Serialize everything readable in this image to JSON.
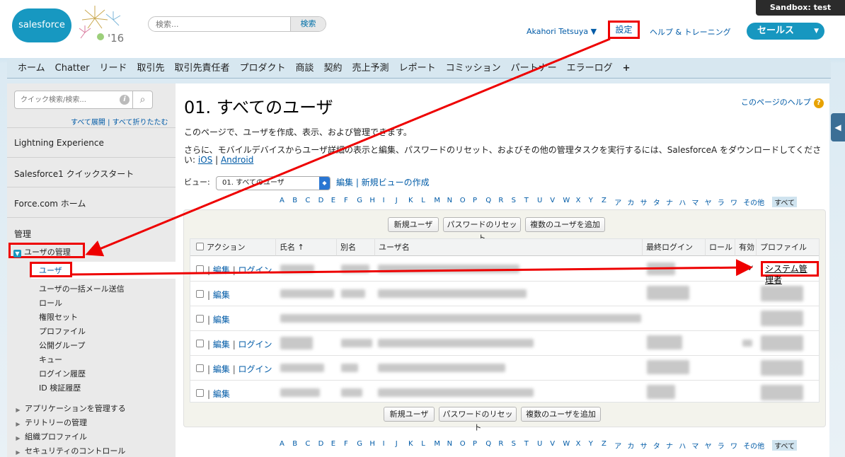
{
  "header": {
    "brand": "salesforce",
    "release": "'16",
    "search_placeholder": "検索...",
    "search_button": "検索",
    "sandbox": "Sandbox:   test",
    "user_name": "Akahori Tetsuya ▼",
    "setup": "設定",
    "help": "ヘルプ & トレーニング",
    "app": "セールス"
  },
  "tabs": [
    "ホーム",
    "Chatter",
    "リード",
    "取引先",
    "取引先責任者",
    "プロダクト",
    "商談",
    "契約",
    "売上予測",
    "レポート",
    "コミッション",
    "パートナー",
    "エラーログ",
    "+"
  ],
  "sidebar": {
    "quick_search_placeholder": "クイック検索/検索...",
    "expand_links": "すべて展開 | すべて折りたたむ",
    "sections": [
      "Lightning Experience",
      "Salesforce1 クイックスタート",
      "Force.com ホーム"
    ],
    "admin_title": "管理",
    "user_mgmt": "ユーザの管理",
    "children": [
      "ユーザ",
      "ユーザの一括メール送信",
      "ロール",
      "権限セット",
      "プロファイル",
      "公開グループ",
      "キュー",
      "ログイン履歴",
      "ID 検証履歴"
    ],
    "collapsed": [
      "アプリケーションを管理する",
      "テリトリーの管理",
      "組織プロファイル",
      "セキュリティのコントロール"
    ]
  },
  "main": {
    "title": "01. すべてのユーザ",
    "help_link": "このページのヘルプ",
    "desc1": "このページで、ユーザを作成、表示、および管理できます。",
    "desc2": "さらに、モバイルデバイスからユーザ詳細の表示と編集、パスワードのリセット、およびその他の管理タスクを実行するには、SalesforceA をダウンロードしてください: ",
    "ios": "iOS",
    "android": "Android",
    "view_label": "ビュー:",
    "view_selected": "01. すべてのユーザ",
    "view_links": "編集 | 新規ビューの作成",
    "alphabet": [
      "A",
      "B",
      "C",
      "D",
      "E",
      "F",
      "G",
      "H",
      "I",
      "J",
      "K",
      "L",
      "M",
      "N",
      "O",
      "P",
      "Q",
      "R",
      "S",
      "T",
      "U",
      "V",
      "W",
      "X",
      "Y",
      "Z",
      "ア",
      "カ",
      "サ",
      "タ",
      "ナ",
      "ハ",
      "マ",
      "ヤ",
      "ラ",
      "ワ",
      "その他",
      "すべて"
    ],
    "buttons": [
      "新規ユーザ",
      "パスワードのリセット",
      "複数のユーザを追加"
    ],
    "columns": [
      "アクション",
      "氏名 ↑",
      "別名",
      "ユーザ名",
      "最終ログイン",
      "ロール",
      "有効",
      "プロファイル"
    ],
    "rows": [
      {
        "edit": "編集",
        "login": "ログイン",
        "active": "✓",
        "profile": "システム管理者"
      },
      {
        "edit": "編集",
        "login": "",
        "active": "",
        "profile": ""
      },
      {
        "edit": "編集",
        "login": "",
        "active": "",
        "profile": ""
      },
      {
        "edit": "編集",
        "login": "ログイン",
        "active": "",
        "profile": ""
      },
      {
        "edit": "編集",
        "login": "ログイン",
        "active": "",
        "profile": ""
      },
      {
        "edit": "編集",
        "login": "",
        "active": "",
        "profile": ""
      }
    ]
  },
  "colors": {
    "accent": "#1797c0",
    "link": "#015ba7",
    "annotation": "#ee0000"
  }
}
